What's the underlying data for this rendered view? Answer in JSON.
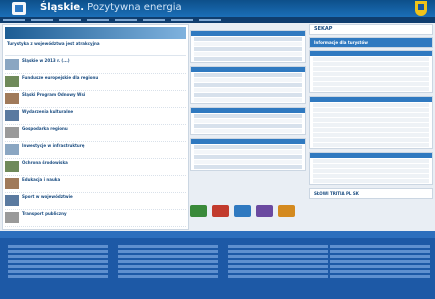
{
  "header": {
    "title": "Śląskie.",
    "subtitle": " Pozytywna energia"
  },
  "nav": {
    "items": [
      "",
      "",
      "",
      "",
      "",
      "",
      "",
      "",
      "",
      ""
    ]
  },
  "left": {
    "news": [
      {
        "title": "Turystyka z województwa jest atrakcyjna",
        "date": ""
      },
      {
        "title": "Śląskie w 2013 r. (...)",
        "date": ""
      },
      {
        "title": "Fundusze europejskie dla regionu",
        "date": ""
      },
      {
        "title": "Śląski Program Odnowy Wsi",
        "date": ""
      },
      {
        "title": "Wydarzenia kulturalne",
        "date": ""
      },
      {
        "title": "Gospodarka regionu",
        "date": ""
      },
      {
        "title": "Inwestycje w infrastrukturę",
        "date": ""
      },
      {
        "title": "Ochrona środowiska",
        "date": ""
      },
      {
        "title": "Edukacja i nauka",
        "date": ""
      },
      {
        "title": "Sport w województwie",
        "date": ""
      },
      {
        "title": "Transport publiczny",
        "date": ""
      }
    ]
  },
  "middle": {
    "boxes": [
      {
        "header": "",
        "lines": [
          "",
          "",
          "",
          "",
          ""
        ]
      },
      {
        "header": "",
        "lines": [
          "",
          "",
          "",
          "",
          "",
          ""
        ]
      },
      {
        "header": "",
        "lines": [
          "",
          "",
          "",
          ""
        ]
      },
      {
        "header": "",
        "lines": [
          "",
          "",
          "",
          "",
          ""
        ]
      }
    ]
  },
  "right": {
    "banners": [
      "SEKAP",
      "Informacje dla turystów"
    ],
    "boxes": [
      {
        "header": "",
        "lines": [
          "",
          "",
          "",
          "",
          "",
          "",
          ""
        ]
      },
      {
        "header": "",
        "lines": [
          "",
          "",
          "",
          "",
          "",
          "",
          "",
          "",
          ""
        ]
      },
      {
        "header": "",
        "lines": [
          "",
          "",
          "",
          "",
          ""
        ]
      }
    ],
    "badge": "SŁOWI TRITIA PL SK"
  },
  "footer": {
    "header": "",
    "colors": {
      "bg": "#1d59a6",
      "accent": "#2f79c0"
    }
  },
  "colors": {
    "accent": "#2f79c0",
    "brand": "#1b6fb8"
  }
}
